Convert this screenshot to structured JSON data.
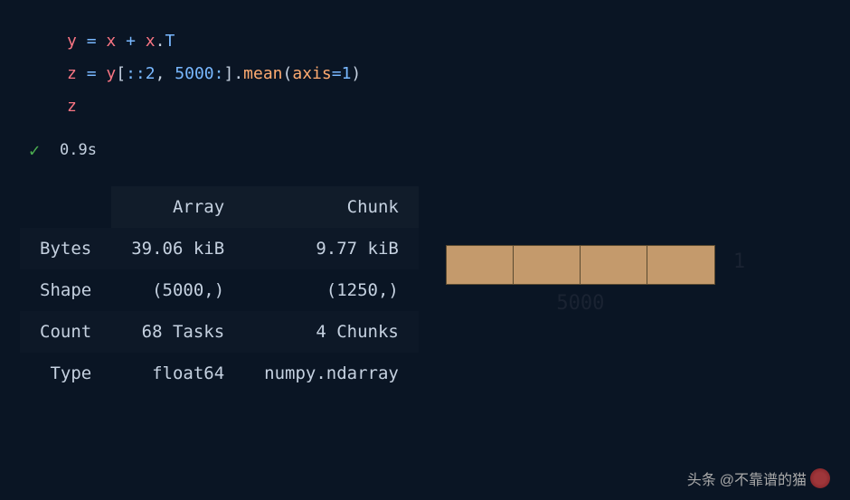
{
  "code": {
    "line1_tokens": [
      "y",
      " ",
      "=",
      " ",
      "x",
      " ",
      "+",
      " ",
      "x",
      ".",
      "T"
    ],
    "line2_tokens": [
      "z",
      " ",
      "=",
      " ",
      "y",
      "[",
      ":",
      ":",
      "2",
      ",",
      " ",
      "5000",
      ":",
      "]",
      ".",
      "mean",
      "(",
      "axis",
      "=",
      "1",
      ")"
    ],
    "line3": "z"
  },
  "status": {
    "time": "0.9s"
  },
  "table": {
    "header_col1": "",
    "header_col2": "Array",
    "header_col3": "Chunk",
    "rows": [
      {
        "label": "Bytes",
        "array": "39.06 kiB",
        "chunk": "9.77 kiB"
      },
      {
        "label": "Shape",
        "array": "(5000,)",
        "chunk": "(1250,)"
      },
      {
        "label": "Count",
        "array": "68 Tasks",
        "chunk": "4 Chunks"
      },
      {
        "label": "Type",
        "array": "float64",
        "chunk": "numpy.ndarray"
      }
    ]
  },
  "diagram": {
    "num_chunks": 4,
    "label_right": "1",
    "label_bottom": "5000"
  },
  "watermark": {
    "prefix": "头条",
    "handle": "@不靠谱的猫"
  }
}
